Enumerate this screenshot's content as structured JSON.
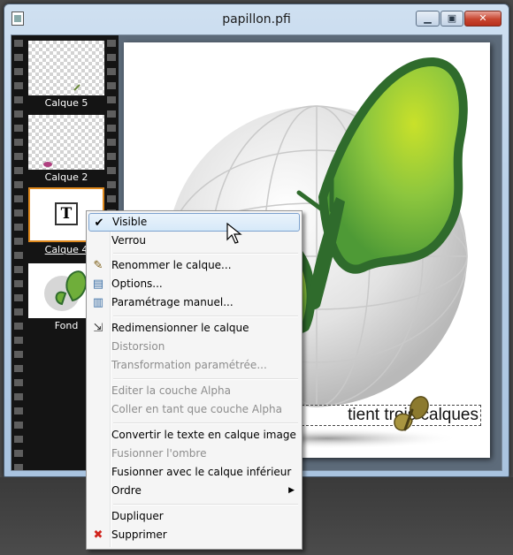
{
  "window": {
    "title": "papillon.pfi",
    "min": "▁",
    "max": "▣",
    "close": "✕"
  },
  "layers": [
    {
      "name": "Calque 5"
    },
    {
      "name": "Calque 2"
    },
    {
      "name": "Calque 4",
      "selected": true,
      "icon": "T"
    },
    {
      "name": "Fond"
    }
  ],
  "canvas": {
    "text": "tient trois calques"
  },
  "context_menu": {
    "items": [
      {
        "label": "Visible",
        "icon": "check-icon",
        "glyph": "✔",
        "highlighted": true
      },
      {
        "label": "Verrou"
      },
      {
        "label": "Renommer le calque...",
        "icon": "rename-icon",
        "glyph": "✎"
      },
      {
        "label": "Options...",
        "icon": "options-icon",
        "glyph": "▤"
      },
      {
        "label": "Paramétrage manuel...",
        "icon": "manual-settings-icon",
        "glyph": "▥"
      },
      {
        "label": "Redimensionner le calque",
        "icon": "resize-icon",
        "glyph": "⇲"
      },
      {
        "label": "Distorsion",
        "disabled": true
      },
      {
        "label": "Transformation paramétrée...",
        "disabled": true
      },
      {
        "label": "Editer la couche Alpha",
        "disabled": true
      },
      {
        "label": "Coller en tant que couche Alpha",
        "disabled": true
      },
      {
        "label": "Convertir le texte en calque image"
      },
      {
        "label": "Fusionner l'ombre",
        "disabled": true
      },
      {
        "label": "Fusionner avec le calque inférieur"
      },
      {
        "label": "Ordre",
        "submenu": true,
        "submenu_glyph": "▶"
      },
      {
        "label": "Dupliquer"
      },
      {
        "label": "Supprimer",
        "icon": "delete-icon",
        "glyph": "✖"
      }
    ]
  },
  "colors": {
    "accent_orange": "#e08a1e",
    "butterfly_green": "#3f7a3a",
    "highlight_blue": "#d6e9f9"
  }
}
